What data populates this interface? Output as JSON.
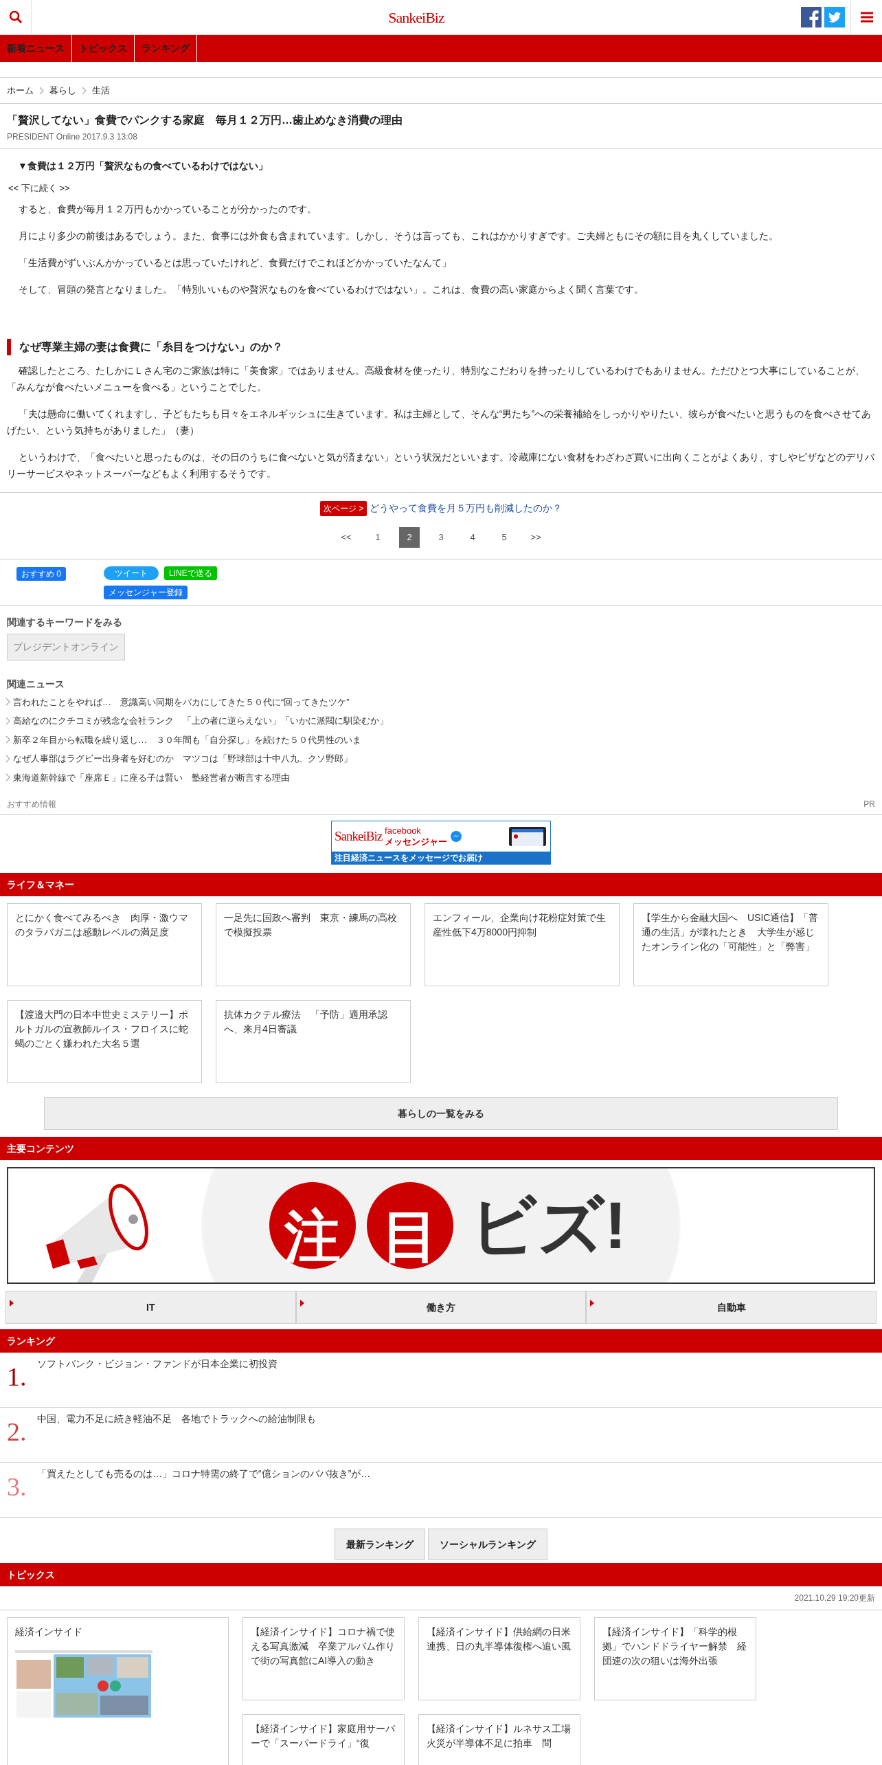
{
  "header": {
    "logo": "SankeiBiz"
  },
  "nav": [
    {
      "label": "新着ニュース"
    },
    {
      "label": "トピックス"
    },
    {
      "label": "ランキング"
    }
  ],
  "breadcrumb": [
    "ホーム",
    "暮らし",
    "生活"
  ],
  "article": {
    "title": "「贅沢してない」食費でパンクする家庭　毎月１２万円…歯止めなき消費の理由",
    "byline": "PRESIDENT Online 2017.9.3 13:08",
    "subheading": "▼食費は１２万円「贅沢なもの食べているわけではない」",
    "continue": "<< 下に続く >>",
    "paragraphs": [
      "すると、食費が毎月１２万円もかかっていることが分かったのです。",
      "月により多少の前後はあるでしょう。また、食事には外食も含まれています。しかし、そうは言っても、これはかかりすぎです。ご夫婦ともにその額に目を丸くしていました。",
      "「生活費がずいぶんかかっているとは思っていたけれど、食費だけでこれほどかかっていたなんて」",
      "そして、冒頭の発言となりました。「特別いいものや贅沢なものを食べているわけではない」。これは、食費の高い家庭からよく聞く言葉です。"
    ],
    "section_heading": "なぜ専業主婦の妻は食費に「糸目をつけない」のか？",
    "section_paragraphs": [
      "確認したところ、たしかにＬさん宅のご家族は特に「美食家」ではありません。高級食材を使ったり、特別なこだわりを持ったりしているわけでもありません。ただひとつ大事にしていることが、「みんなが食べたいメニューを食べる」ということでした。",
      "「夫は懸命に働いてくれますし、子どもたちも日々をエネルギッシュに生きています。私は主婦として、そんな“男たち”への栄養補給をしっかりやりたい、彼らが食べたいと思うものを食べさせてあげたい、という気持ちがありました」（妻）",
      "というわけで、「食べたいと思ったものは、その日のうちに食べないと気が済まない」という状況だといいます。冷蔵庫にない食材をわざわざ買いに出向くことがよくあり、すしやピザなどのデリバリーサービスやネットスーパーなどもよく利用するそうです。"
    ]
  },
  "next_page": {
    "badge": "次ページ >",
    "link": "どうやって食費を月５万円も削減したのか？"
  },
  "pagination": [
    {
      "label": "<<",
      "selected": false
    },
    {
      "label": "1",
      "selected": false
    },
    {
      "label": "2",
      "selected": true
    },
    {
      "label": "3",
      "selected": false
    },
    {
      "label": "4",
      "selected": false
    },
    {
      "label": "5",
      "selected": false
    },
    {
      "label": ">>",
      "selected": false
    }
  ],
  "share": {
    "facebook": "おすすめ 0",
    "twitter": "ツイート",
    "line": "LINEで送る",
    "messenger": "メッセンジャー登録"
  },
  "keywords": {
    "title": "関連するキーワードをみる",
    "tags": [
      "プレジデントオンライン"
    ]
  },
  "related_news": {
    "title": "関連ニュース",
    "items": [
      "言われたことをやれば…　意識高い同期をバカにしてきた５０代に“回ってきたツケ”",
      "高給なのにクチコミが残念な会社ランク　「上の者に逆らえない」「いかに派閥に馴染むか」",
      "新卒２年目から転職を繰り返し…　３０年間も「自分探し」を続けた５０代男性のいま",
      "なぜ人事部はラグビー出身者を好むのか　マツコは「野球部は十中八九、クソ野郎」",
      "東海道新幹線で「座席Ｅ」に座る子は賢い　塾経営者が断言する理由"
    ]
  },
  "recommend": {
    "label": "おすすめ情報",
    "pr": "PR"
  },
  "messenger_banner": {
    "brand": "SankeiBiz",
    "service": "facebook",
    "service_sub": "メッセンジャー",
    "caption": "注目経済ニュースをメッセージでお届け"
  },
  "life_money": {
    "title": "ライフ＆マネー",
    "cards": [
      "とにかく食べてみるべき　肉厚・激ウマのタラバガニは感動レベルの満足度",
      "一足先に国政へ審判　東京・練馬の高校で模擬投票",
      "エンフィール、企業向け花粉症対策で生産性低下4万8000円抑制",
      "【学生から金融大国へ　USIC通信】「普通の生活」が壊れたとき　大学生が感じたオンライン化の「可能性」と「弊害」",
      "【渡邉大門の日本中世史ミステリー】ポルトガルの宣教師ルイス・フロイスに蛇蝎のごとく嫌われた大名５選",
      "抗体カクテル療法　「予防」適用承認へ、来月4日審議"
    ],
    "more": "暮らしの一覧をみる"
  },
  "main_contents": {
    "title": "主要コンテンツ",
    "banner": {
      "marks": [
        "注",
        "目"
      ],
      "text": "ビズ!"
    },
    "categories": [
      "IT",
      "働き方",
      "自動車"
    ]
  },
  "ranking": {
    "title": "ランキング",
    "items": [
      {
        "rank": "1.",
        "title": "ソフトバンク・ビジョン・ファンドが日本企業に初投資",
        "color": "#aa0000"
      },
      {
        "rank": "2.",
        "title": "中国、電力不足に続き軽油不足　各地でトラックへの給油制限も",
        "color": "#cc4444"
      },
      {
        "rank": "3.",
        "title": "「買えたとしても売るのは…」コロナ特需の終了で“億ションのババ抜き”が…",
        "color": "#e07a86"
      }
    ],
    "buttons": [
      "最新ランキング",
      "ソーシャルランキング"
    ]
  },
  "topics": {
    "title": "トピックス",
    "updated": "2021.10.29 19:20更新",
    "feature": {
      "title": "経済インサイド",
      "kind": "picture"
    },
    "cards": [
      "【経済インサイド】コロナ禍で使える写真激減　卒業アルバム作りで街の写真館にAI導入の動き",
      "【経済インサイド】供給網の日米連携、日の丸半導体復権へ追い風",
      "【経済インサイド】「科学的根拠」でハンドドライヤー解禁　経団連の次の狙いは海外出張",
      "【経済インサイド】家庭用サーバーで「スーパードライ」“復",
      "【経済インサイド】ルネサス工場火災が半導体不足に拍車　問"
    ]
  }
}
